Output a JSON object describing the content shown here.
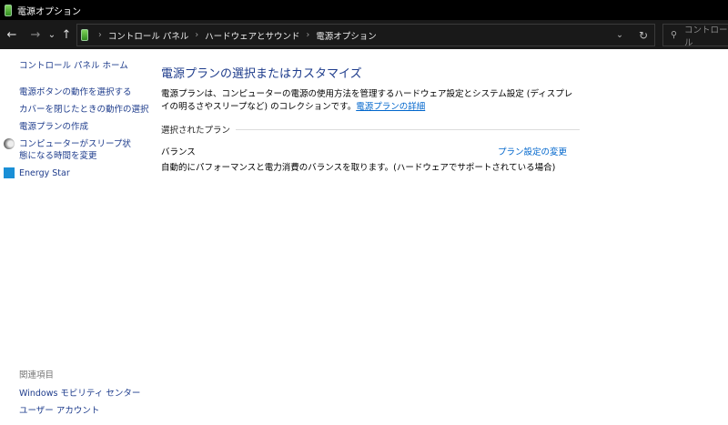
{
  "window": {
    "title": "電源オプション"
  },
  "nav": {
    "back": "←",
    "forward": "→",
    "recent": "⌄",
    "up": "↑",
    "breadcrumb": [
      "コントロール パネル",
      "ハードウェアとサウンド",
      "電源オプション"
    ],
    "search_placeholder": "コントロール"
  },
  "sidebar": {
    "home": "コントロール パネル ホーム",
    "items": [
      {
        "label": "電源ボタンの動作を選択する"
      },
      {
        "label": "カバーを閉じたときの動作の選択"
      },
      {
        "label": "電源プランの作成"
      },
      {
        "label": "コンピューターがスリープ状態になる時間を変更",
        "icon": "moon-icon"
      },
      {
        "label": "Energy Star",
        "icon": "energy-star-icon"
      }
    ],
    "related_title": "関連項目",
    "related": [
      "Windows モビリティ センター",
      "ユーザー アカウント"
    ]
  },
  "main": {
    "title": "電源プランの選択またはカスタマイズ",
    "description": "電源プランは、コンピューターの電源の使用方法を管理するハードウェア設定とシステム設定 (ディスプレイの明るさやスリープなど) のコレクションです。",
    "details_link": "電源プランの詳細",
    "group_label": "選択されたプラン",
    "plan": {
      "name": "バランス",
      "description": "自動的にパフォーマンスと電力消費のバランスを取ります。(ハードウェアでサポートされている場合)",
      "change_link": "プラン設定の変更"
    }
  }
}
